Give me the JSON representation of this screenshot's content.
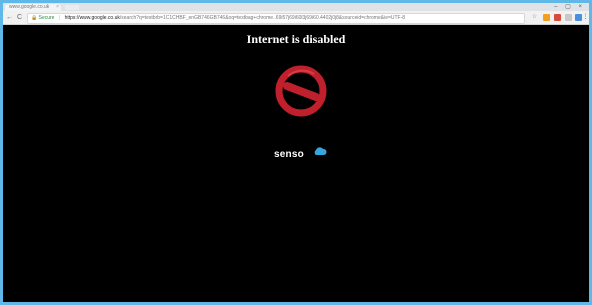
{
  "browser": {
    "tab_title": "www.google.co.uk",
    "tab_close": "×",
    "window_controls": "– ▢ ×",
    "nav": {
      "back": "←",
      "forward": "→",
      "reload": "C"
    },
    "address_bar": {
      "secure_label": "Secure",
      "separator": "|",
      "url_host": "https://www.google.co.uk",
      "url_rest": "/search?q=testbrb=1C1CHBF_enGB746GB746&oq=testbag+chrome..69i57j69i60l3j69i60.4402j0j8&sourceid=chrome&ie=UTF-8"
    },
    "toolbar_icons": [
      "star-icon",
      "extension-icon",
      "extension-icon",
      "extension-icon",
      "extension-icon",
      "menu-icon"
    ]
  },
  "page": {
    "heading": "Internet is disabled",
    "logo_text": "senso",
    "colors": {
      "background": "#000000",
      "no_entry": "#c0202b",
      "cloud": "#35a6e0",
      "frame": "#5fb8e8"
    }
  }
}
